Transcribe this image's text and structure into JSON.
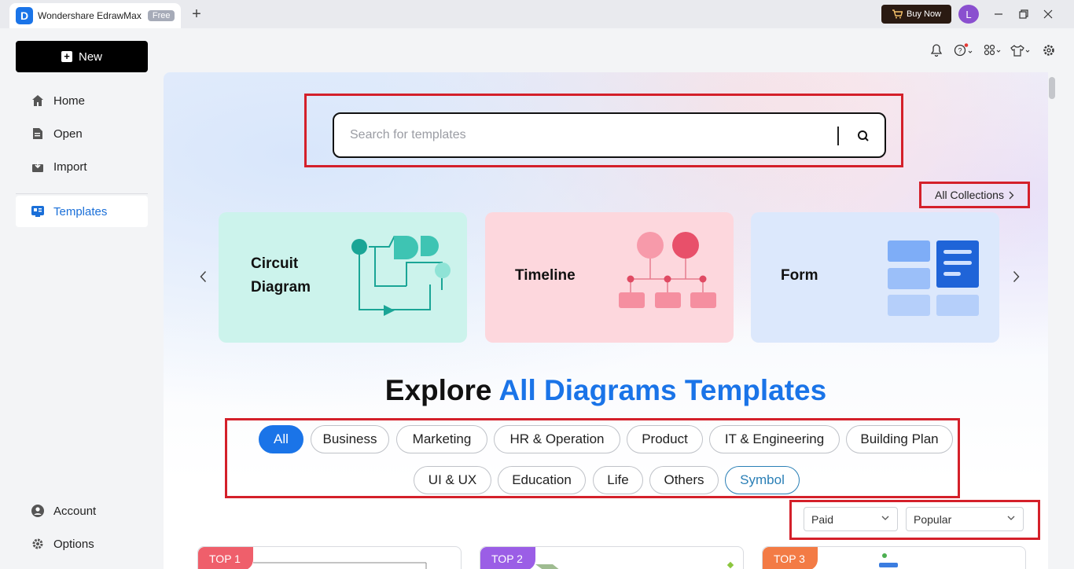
{
  "titlebar": {
    "app_title": "Wondershare EdrawMax",
    "free_badge": "Free",
    "new_tab_symbol": "+",
    "buy_now_label": "Buy Now",
    "avatar_initial": "L"
  },
  "sidebar": {
    "new_label": "New",
    "items": [
      {
        "label": "Home",
        "icon": "home-icon"
      },
      {
        "label": "Open",
        "icon": "file-icon"
      },
      {
        "label": "Import",
        "icon": "import-icon"
      },
      {
        "label": "Templates",
        "icon": "templates-icon",
        "active": true
      }
    ],
    "bottom_items": [
      {
        "label": "Account",
        "icon": "account-icon"
      },
      {
        "label": "Options",
        "icon": "gear-icon"
      }
    ]
  },
  "search": {
    "placeholder": "Search for templates",
    "value": ""
  },
  "collections": {
    "all_collections_label": "All Collections"
  },
  "carousel": {
    "cards": [
      {
        "label": "Circuit Diagram",
        "line1": "Circuit",
        "line2": "Diagram",
        "bg": "#ccf3ec"
      },
      {
        "label": "Timeline",
        "bg": "#fdd7dd"
      },
      {
        "label": "Form",
        "bg": "#dce8fc"
      }
    ]
  },
  "explore": {
    "prefix": "Explore",
    "accent": "All Diagrams Templates"
  },
  "categories": {
    "row1": [
      "All",
      "Business",
      "Marketing",
      "HR & Operation",
      "Product",
      "IT & Engineering",
      "Building Plan"
    ],
    "row2": [
      "UI & UX",
      "Education",
      "Life",
      "Others",
      "Symbol"
    ],
    "selected": "All"
  },
  "filters": {
    "price": "Paid",
    "sort": "Popular"
  },
  "top_templates": [
    {
      "badge": "TOP 1",
      "color": "#ef5f6b"
    },
    {
      "badge": "TOP 2",
      "color": "#9b5ee6"
    },
    {
      "badge": "TOP 3",
      "color": "#f37b45"
    }
  ],
  "colors": {
    "accent": "#1a74e8",
    "highlight": "#d4202a"
  }
}
